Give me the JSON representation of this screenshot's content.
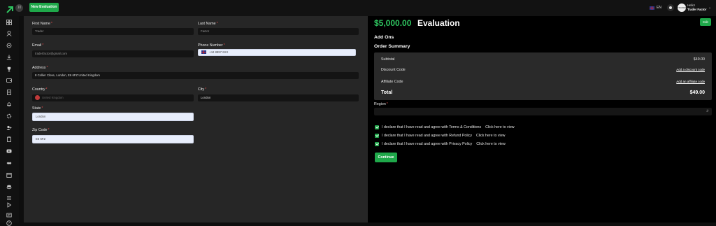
{
  "topbar": {
    "badge_text": "10",
    "new_evaluation_label": "New Evaluation",
    "language": "EN",
    "user_greeting": "Hello!",
    "user_name": "Trader Factor",
    "avatar_text": "TRADERFACTOR"
  },
  "sidebar": {
    "icons": [
      "dashboard-icon",
      "user-icon",
      "gear-icon",
      "download-icon",
      "trophy-icon",
      "wallet-icon",
      "document-icon",
      "bell-icon",
      "settings-icon",
      "add-user-icon",
      "clipboard-icon",
      "video-icon",
      "handshake-icon",
      "calendar-icon",
      "coins-icon",
      "list-icon",
      "play-icon",
      "certificate-icon",
      "help-icon"
    ]
  },
  "form": {
    "first_name": {
      "label": "First Name",
      "value": "Trader"
    },
    "last_name": {
      "label": "Last Name",
      "value": "Factor"
    },
    "email": {
      "label": "Email",
      "value": "traderfactor@gmail.com"
    },
    "phone": {
      "label": "Phone Number",
      "value": "+44 8897 6XX"
    },
    "address": {
      "label": "Address",
      "value": "8 Collier Close, London, E6 6FZ United Kingdom"
    },
    "country": {
      "label": "Country",
      "placeholder": "United Kingdom"
    },
    "city": {
      "label": "City",
      "value": "London"
    },
    "state": {
      "label": "State",
      "value": "London"
    },
    "zip": {
      "label": "Zip Code",
      "value": "E6 6FZ"
    },
    "required_mark": "*"
  },
  "evaluation": {
    "price": "$5,000.00",
    "title": "Evaluation",
    "edit_label": "Edit",
    "add_ons_title": "Add Ons",
    "order_summary_title": "Order Summary",
    "summary": {
      "subtotal_label": "Subtotal",
      "subtotal_value": "$49.00",
      "discount_label": "Discount Code",
      "discount_link": "Add a discount code",
      "affiliate_label": "Affiliate Code",
      "affiliate_link": "Add an affiliate code",
      "total_label": "Total",
      "total_value": "$49.00"
    },
    "region_label": "Region",
    "declarations": [
      {
        "text": "I declare that I have read and agree with Terms & Conditions",
        "link": "Click here to view"
      },
      {
        "text": "I declare that I have read and agree with Refund Policy",
        "link": "Click here to view"
      },
      {
        "text": "I declare that I have read and agree with Privacy Policy",
        "link": "Click here to view"
      }
    ],
    "continue_label": "Continue"
  },
  "colors": {
    "accent": "#1fa84a",
    "price_green": "#2ec35f",
    "panel_left": "#262626",
    "panel_right": "#000000"
  }
}
